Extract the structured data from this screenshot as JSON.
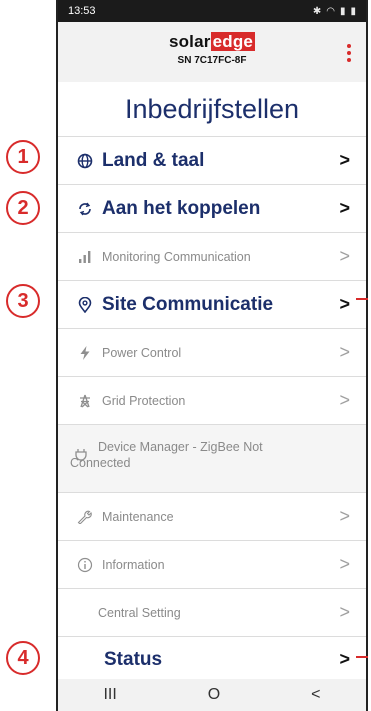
{
  "status_bar": {
    "time": "13:53",
    "icons": [
      "bluetooth-icon",
      "wifi-icon",
      "signal-icon",
      "battery-icon"
    ]
  },
  "header": {
    "logo_part1": "solar",
    "logo_part2": "edge",
    "serial": "SN 7C17FC-8F",
    "brand_color": "#d82b2b"
  },
  "page": {
    "title": "Inbedrijfstellen"
  },
  "menu": {
    "land": {
      "label": "Land & taal",
      "icon": "globe-icon"
    },
    "pairing": {
      "label": "Aan het koppelen",
      "icon": "pairing-icon"
    },
    "monitoring": {
      "label": "Monitoring Communication",
      "icon": "bar-chart-icon"
    },
    "site_comm": {
      "label": "Site Communicatie",
      "icon": "location-pin-icon"
    },
    "power": {
      "label": "Power Control",
      "icon": "lightning-icon"
    },
    "grid": {
      "label": "Grid Protection",
      "icon": "transmission-tower-icon"
    },
    "device_manager": {
      "label": "Device Manager - ZigBee Not Connected",
      "icon": "plug-icon"
    },
    "maintenance": {
      "label": "Maintenance",
      "icon": "wrench-icon"
    },
    "information": {
      "label": "Information",
      "icon": "info-icon"
    },
    "central": {
      "label": "Central Setting"
    },
    "status": {
      "label": "Status"
    },
    "chevron": ">"
  },
  "callouts": [
    "1",
    "2",
    "3",
    "4"
  ],
  "navbar": {
    "recent": "III",
    "home": "O",
    "back": "<"
  },
  "colors": {
    "title": "#1c2f6b",
    "accent": "#d82b2b",
    "muted": "#8a8a8a"
  }
}
